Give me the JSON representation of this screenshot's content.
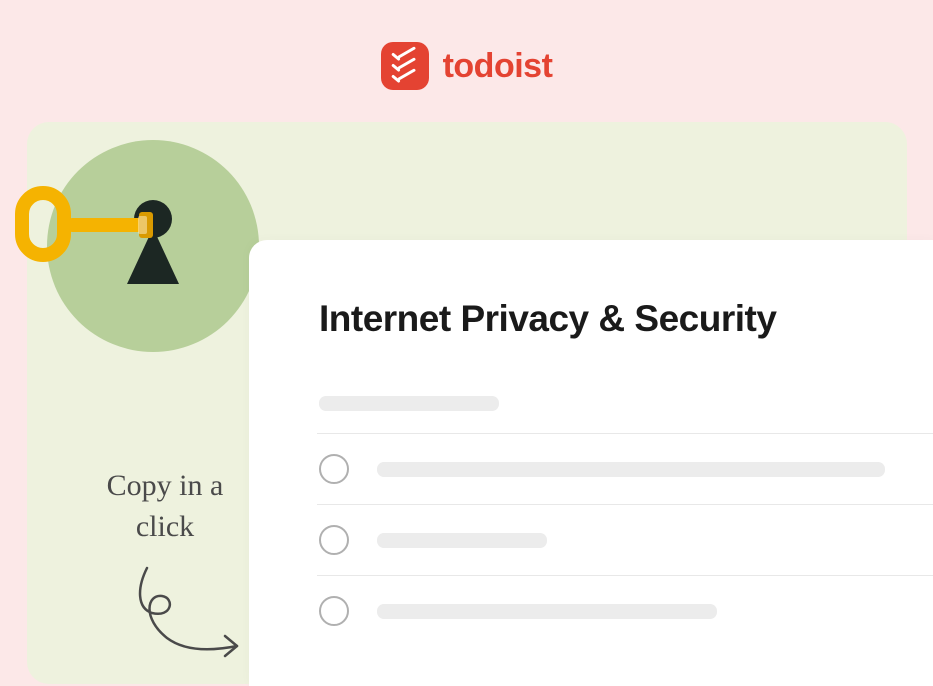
{
  "brand": {
    "name": "todoist"
  },
  "template": {
    "title": "Internet Privacy & Security",
    "cta": "Copy in a click"
  }
}
